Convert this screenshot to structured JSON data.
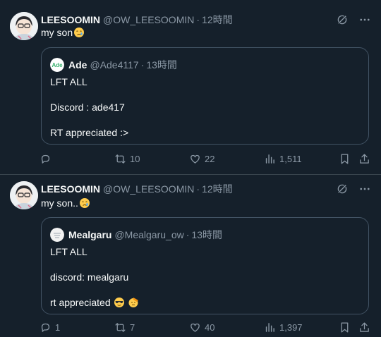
{
  "tweets": [
    {
      "author_name": "LEESOOMIN",
      "author_handle": "@OW_LEESOOMIN",
      "separator": "·",
      "time": "12時間",
      "text": "my son",
      "text_emoji": "crying-face",
      "quote": {
        "author_name": "Ade",
        "author_handle": "@Ade4117",
        "separator": "·",
        "time": "13時間",
        "lines": [
          "LFT ALL",
          "Discord : ade417",
          "RT appreciated :>"
        ]
      },
      "actions": {
        "replies": "",
        "retweets": "10",
        "likes": "22",
        "views": "1,511"
      }
    },
    {
      "author_name": "LEESOOMIN",
      "author_handle": "@OW_LEESOOMIN",
      "separator": "·",
      "time": "12時間",
      "text": "my son..",
      "text_emoji": "crying-face",
      "quote": {
        "author_name": "Mealgaru",
        "author_handle": "@Mealgaru_ow",
        "separator": "·",
        "time": "13時間",
        "lines": [
          "LFT ALL",
          "discord: mealgaru",
          "rt appreciated"
        ],
        "line_emojis": [
          "sunglasses-face",
          "saluting-face"
        ]
      },
      "actions": {
        "replies": "1",
        "retweets": "7",
        "likes": "40",
        "views": "1,397"
      }
    }
  ],
  "icons": [
    "grok-icon",
    "more-icon",
    "reply-icon",
    "retweet-icon",
    "like-icon",
    "views-icon",
    "bookmark-icon",
    "share-icon"
  ],
  "colors": {
    "background": "#15202b",
    "muted": "#8b98a5",
    "border": "#38444d",
    "text": "#f7f9f9"
  }
}
